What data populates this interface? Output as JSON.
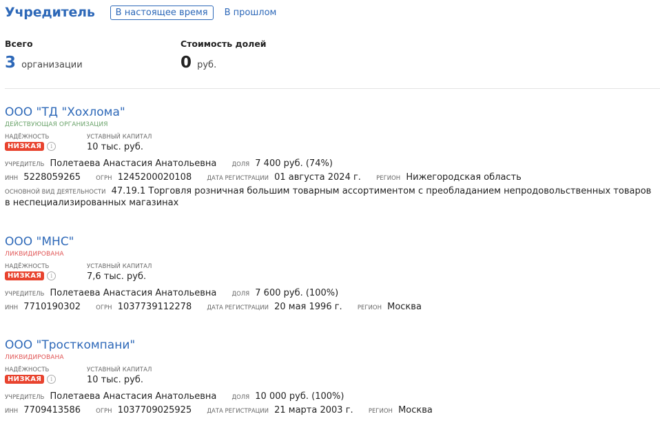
{
  "header": {
    "title": "Учредитель",
    "tabs": [
      {
        "label": "В настоящее время",
        "active": true
      },
      {
        "label": "В прошлом",
        "active": false
      }
    ]
  },
  "summary": {
    "total_label": "Всего",
    "total_value": "3",
    "total_unit": "организации",
    "shares_label": "Стоимость долей",
    "shares_value": "0",
    "shares_unit": "руб."
  },
  "labels": {
    "reliability": "Надёжность",
    "capital": "Уставный капитал",
    "founder": "Учредитель",
    "share": "доля",
    "inn": "ИНН",
    "ogrn": "ОГРН",
    "reg_date": "Дата регистрации",
    "region": "Регион",
    "activity": "Основной вид деятельности"
  },
  "companies": [
    {
      "name": "ООО \"ТД \"Хохлома\"",
      "status": "Действующая организация",
      "reliability": "НИЗКАЯ",
      "capital": "10 тыс. руб.",
      "founder": "Полетаева Анастасия Анатольевна",
      "share": "7 400 руб. (74%)",
      "inn": "5228059265",
      "ogrn": "1245200020108",
      "reg_date": "01 августа 2024 г.",
      "region": "Нижегородская область",
      "activity": "47.19.1 Торговля розничная большим товарным ассортиментом с преобладанием непродовольственных товаров в неспециализированных магазинах"
    },
    {
      "name": "ООО \"МНС\"",
      "status": "Ликвидирована",
      "reliability": "НИЗКАЯ",
      "capital": "7,6 тыс. руб.",
      "founder": "Полетаева Анастасия Анатольевна",
      "share": "7 600 руб. (100%)",
      "inn": "7710190302",
      "ogrn": "1037739112278",
      "reg_date": "20 мая 1996 г.",
      "region": "Москва"
    },
    {
      "name": "ООО \"Тросткомпани\"",
      "status": "Ликвидирована",
      "reliability": "НИЗКАЯ",
      "capital": "10 тыс. руб.",
      "founder": "Полетаева Анастасия Анатольевна",
      "share": "10 000 руб. (100%)",
      "inn": "7709413586",
      "ogrn": "1037709025925",
      "reg_date": "21 марта 2003 г.",
      "region": "Москва"
    }
  ]
}
